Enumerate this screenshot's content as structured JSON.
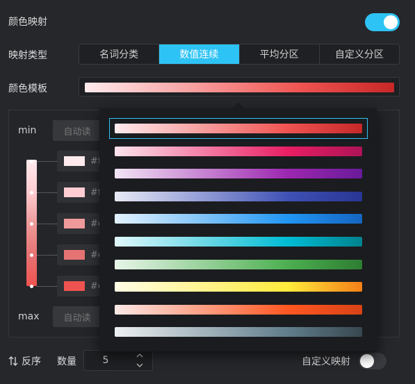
{
  "color_mapping": {
    "label": "颜色映射",
    "enabled": true
  },
  "mapping_type": {
    "label": "映射类型",
    "options": [
      "名词分类",
      "数值连续",
      "平均分区",
      "自定义分区"
    ],
    "selected_index": 1
  },
  "color_template": {
    "label": "颜色模板"
  },
  "range": {
    "min_label": "min",
    "max_label": "max",
    "auto_read_label": "自动读"
  },
  "stops": [
    {
      "hex": "#ffebee",
      "text": "#ff"
    },
    {
      "hex": "#ffcdd2",
      "text": "#ff"
    },
    {
      "hex": "#ef9a9a",
      "text": "#e"
    },
    {
      "hex": "#e57373",
      "text": "#e"
    },
    {
      "hex": "#ef5350",
      "text": "#e"
    }
  ],
  "footer": {
    "reverse_label": "反序",
    "count_label": "数量",
    "count_value": "5",
    "custom_mapping_label": "自定义映射",
    "custom_mapping_enabled": false
  },
  "templates": [
    {
      "name": "red",
      "from": "#ffebee",
      "mid": "#ef5350",
      "to": "#c62828"
    },
    {
      "name": "pink",
      "from": "#fce4ec",
      "mid": "#e91e63",
      "to": "#ad1457"
    },
    {
      "name": "purple",
      "from": "#f3e5f5",
      "mid": "#9c27b0",
      "to": "#6a1b9a"
    },
    {
      "name": "indigo",
      "from": "#e8eaf6",
      "mid": "#3f51b5",
      "to": "#283593"
    },
    {
      "name": "blue",
      "from": "#e3f2fd",
      "mid": "#2196f3",
      "to": "#1565c0"
    },
    {
      "name": "cyan",
      "from": "#e0f7fa",
      "mid": "#00bcd4",
      "to": "#00838f"
    },
    {
      "name": "green",
      "from": "#e8f5e9",
      "mid": "#4caf50",
      "to": "#2e7d32"
    },
    {
      "name": "yellow",
      "from": "#fffde7",
      "mid": "#ffeb3b",
      "to": "#f57f17"
    },
    {
      "name": "deep-orange",
      "from": "#fbe9e7",
      "mid": "#ff5722",
      "to": "#d84315"
    },
    {
      "name": "blue-grey",
      "from": "#eceff1",
      "mid": "#607d8b",
      "to": "#37474f"
    }
  ],
  "selected_template_index": 0,
  "accent": "#2ec3f5"
}
